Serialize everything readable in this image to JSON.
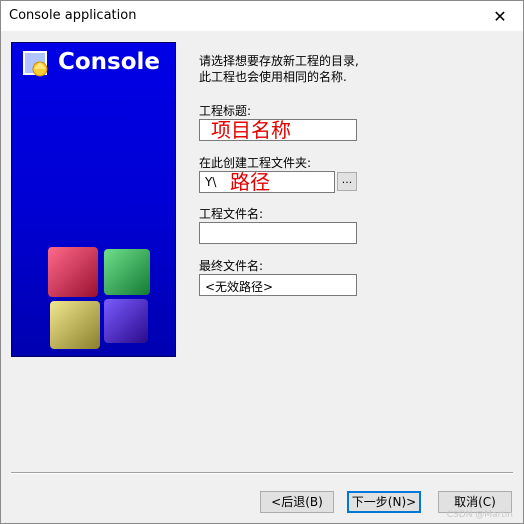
{
  "window": {
    "title": "Console application",
    "close_glyph": "✕"
  },
  "banner": {
    "title": "Console",
    "logo_icon": "codeblocks-logo-icon",
    "cube_icon": "cubes-icon"
  },
  "description": {
    "line1": "请选择想要存放新工程的目录,",
    "line2": "此工程也会使用相同的名称."
  },
  "form": {
    "project_title_label": "工程标题:",
    "project_title_value": "",
    "project_title_overlay": "项目名称",
    "folder_label": "在此创建工程文件夹:",
    "folder_value": "Y\\",
    "folder_overlay": "路径",
    "browse_label": "...",
    "project_filename_label": "工程文件名:",
    "project_filename_value": "",
    "result_filename_label": "最终文件名:",
    "result_filename_value": "<无效路径>"
  },
  "buttons": {
    "back": "<后退(B)",
    "next": "下一步(N)>",
    "cancel": "取消(C)"
  },
  "watermark": "CSDN @Martin"
}
